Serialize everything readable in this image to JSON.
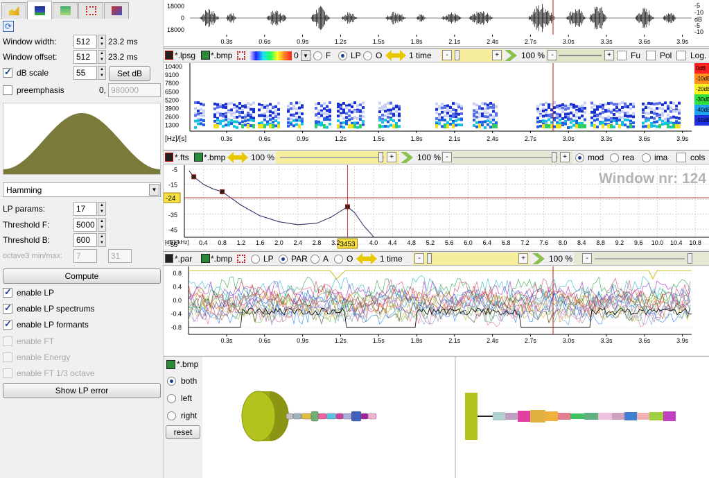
{
  "tabs": [
    {
      "name": "waveform-tab",
      "color": "#f0c030"
    },
    {
      "name": "lpc-tab",
      "color": "#2a3fa8"
    },
    {
      "name": "spectrum-tab",
      "color": "#3bb54a"
    },
    {
      "name": "formant-tab",
      "color": "#d02020"
    },
    {
      "name": "extra-tab",
      "color": "#8c3fb0"
    }
  ],
  "settings": {
    "window_width_label": "Window width:",
    "window_width_value": "512",
    "window_width_ms": "23.2 ms",
    "window_offset_label": "Window offset:",
    "window_offset_value": "512",
    "window_offset_ms": "23.2 ms",
    "db_scale_label": "dB scale",
    "db_scale_value": "55",
    "set_db_label": "Set dB",
    "preemphasis_label": "preemphasis",
    "preemphasis_prefix": "0,",
    "preemphasis_value": "980000",
    "window_type": "Hamming",
    "lp_params_label": "LP params:",
    "lp_params_value": "17",
    "threshold_f_label": "Threshold F:",
    "threshold_f_value": "5000",
    "threshold_b_label": "Threshold B:",
    "threshold_b_value": "600",
    "octave_label": "octave3 min/max:",
    "octave_min": "7",
    "octave_max": "31",
    "compute_label": "Compute",
    "enable_lp_label": "enable LP",
    "enable_lp_spectrums_label": "enable LP spectrums",
    "enable_lp_formants_label": "enable LP formants",
    "enable_ft_label": "enable FT",
    "enable_energy_label": "enable Energy",
    "enable_ft13_label": "enable FT 1/3 octave",
    "show_lp_error_label": "Show LP error"
  },
  "time_ticks": [
    "0.3s",
    "0.6s",
    "0.9s",
    "1.2s",
    "1.5s",
    "1.8s",
    "2.1s",
    "2.4s",
    "2.7s",
    "3.0s",
    "3.3s",
    "3.6s",
    "3.9s"
  ],
  "waveform": {
    "y_left": [
      "18000",
      "0",
      "18000"
    ],
    "y_right": [
      "-5",
      "-10",
      "dB",
      "-5",
      "-10"
    ]
  },
  "spectrogram_toolbar": {
    "file1": "*.lpsg",
    "file2": "*.bmp",
    "palette_value": "0",
    "r1": "F",
    "r2": "LP",
    "r3": "O",
    "zoom_label": "1 time",
    "percent": "100 %",
    "c1": "Fu",
    "c2": "Pol",
    "c3": "Log."
  },
  "spectrogram": {
    "y_labels": [
      "10400",
      "9100",
      "7800",
      "6500",
      "5200",
      "3900",
      "2600",
      "1300"
    ],
    "unit_label": "[Hz]/[s]",
    "db_scale": [
      "0dB",
      "-10dB",
      "-20dB",
      "-30dB",
      "-40dB",
      "-50dB"
    ]
  },
  "lp_toolbar": {
    "file1": "*.fts",
    "file2": "*.bmp",
    "percent1": "100 %",
    "percent2": "100 %",
    "r1": "mod",
    "r2": "rea",
    "r3": "ima",
    "c1": "cols"
  },
  "lp_spectrum": {
    "window_label": "Window nr: 124",
    "y_labels": [
      "-5",
      "-15",
      "-25",
      "-35",
      "-45",
      "-55"
    ],
    "marker_y": "-24",
    "marker_x": "3453",
    "unit_label": "[dB]/[kHz]",
    "x_labels": [
      "0.4",
      "0.8",
      "1.2",
      "1.6",
      "2.0",
      "2.4",
      "2.8",
      "3.2",
      "3.6",
      "4.0",
      "4.4",
      "4.8",
      "5.2",
      "5.6",
      "6.0",
      "6.4",
      "6.8",
      "7.2",
      "7.6",
      "8.0",
      "8.4",
      "8.8",
      "9.2",
      "9.6",
      "10.0",
      "10.4",
      "10.8"
    ]
  },
  "param_toolbar": {
    "file1": "*.par",
    "file2": "*.bmp",
    "r1": "LP",
    "r2": "PAR",
    "r3": "A",
    "r4": "O",
    "zoom_label": "1 time",
    "percent": "100 %"
  },
  "param_plot": {
    "y_labels": [
      "0.8",
      "0.4",
      "0.0",
      "-0.4",
      "-0.8"
    ]
  },
  "tube": {
    "file": "*.bmp",
    "both_label": "both",
    "left_label": "left",
    "right_label": "right",
    "reset_label": "reset"
  },
  "colors": {
    "window_fill": "#7a7a3a",
    "tube_color": "#b4c21e",
    "marker_line": "#b01818",
    "curve": "#20205a"
  }
}
